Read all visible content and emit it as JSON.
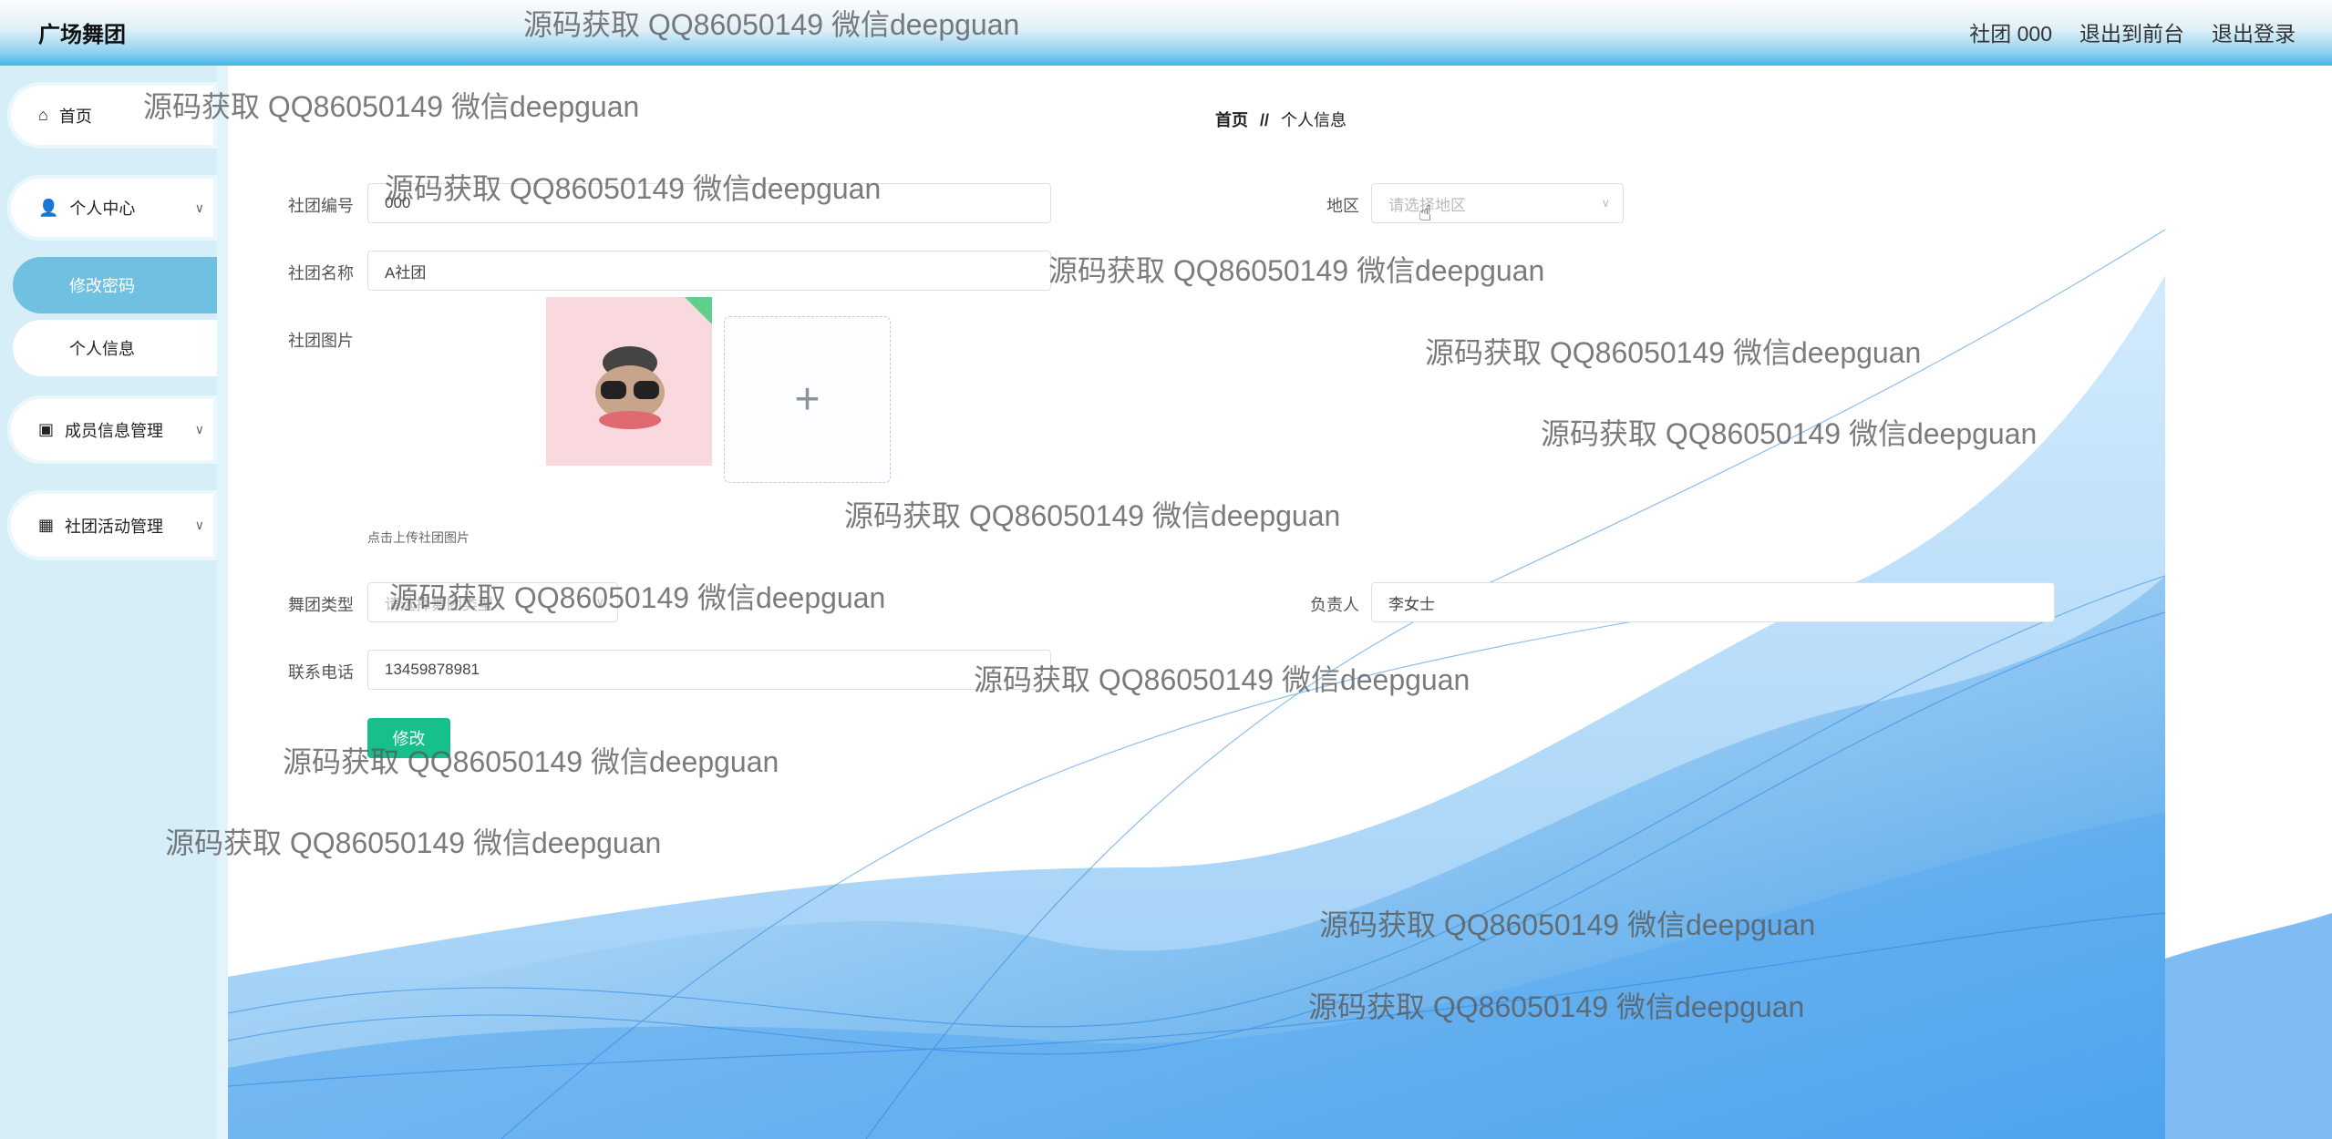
{
  "header": {
    "title": "广场舞团",
    "user": "社团 000",
    "to_front": "退出到前台",
    "logout": "退出登录"
  },
  "sidebar": {
    "home": "首页",
    "personal_center": "个人中心",
    "change_password": "修改密码",
    "personal_info": "个人信息",
    "member_mgmt": "成员信息管理",
    "activity_mgmt": "社团活动管理"
  },
  "breadcrumb": {
    "home": "首页",
    "sep": "//",
    "current": "个人信息"
  },
  "form": {
    "club_no_label": "社团编号",
    "club_no": "000",
    "region_label": "地区",
    "region_placeholder": "请选择地区",
    "club_name_label": "社团名称",
    "club_name": "A社团",
    "club_image_label": "社团图片",
    "upload_hint": "点击上传社团图片",
    "upload_plus": "+",
    "dance_type_label": "舞团类型",
    "dance_type_placeholder": "请选择舞团类型",
    "leader_label": "负责人",
    "leader": "李女士",
    "phone_label": "联系电话",
    "phone": "13459878981",
    "submit": "修改"
  },
  "watermark": "源码获取 QQ86050149 微信deepguan",
  "colors": {
    "accent": "#17c08b",
    "active_nav": "#6fc0e1",
    "header_blue": "#43b5e6"
  }
}
